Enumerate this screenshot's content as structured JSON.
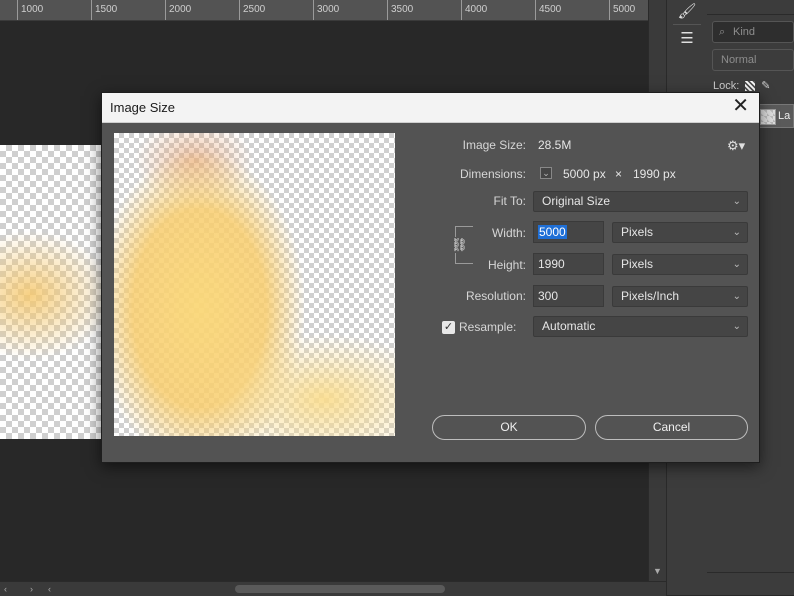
{
  "ruler": {
    "ticks": [
      "1000",
      "1500",
      "2000",
      "2500",
      "3000",
      "3500",
      "4000",
      "4500",
      "5000"
    ]
  },
  "layers_panel": {
    "kind_placeholder": "Kind",
    "blend_mode": "Normal",
    "lock_label": "Lock:",
    "layer_label": "La"
  },
  "dialog": {
    "title": "Image Size",
    "close_glyph": "✕",
    "image_size_label": "Image Size:",
    "image_size_value": "28.5M",
    "dimensions_label": "Dimensions:",
    "dimensions_width": "5000 px",
    "dimensions_times": "×",
    "dimensions_height": "1990 px",
    "fit_to_label": "Fit To:",
    "fit_to_value": "Original Size",
    "width_label": "Width:",
    "width_value": "5000",
    "width_unit": "Pixels",
    "height_label": "Height:",
    "height_value": "1990",
    "height_unit": "Pixels",
    "resolution_label": "Resolution:",
    "resolution_value": "300",
    "resolution_unit": "Pixels/Inch",
    "resample_label": "Resample:",
    "resample_checked": true,
    "resample_value": "Automatic",
    "ok_label": "OK",
    "cancel_label": "Cancel"
  },
  "colors": {
    "dialog_bg": "#535353",
    "accent_selection": "#1f6fd6",
    "titlebar": "#f3f3f3"
  }
}
